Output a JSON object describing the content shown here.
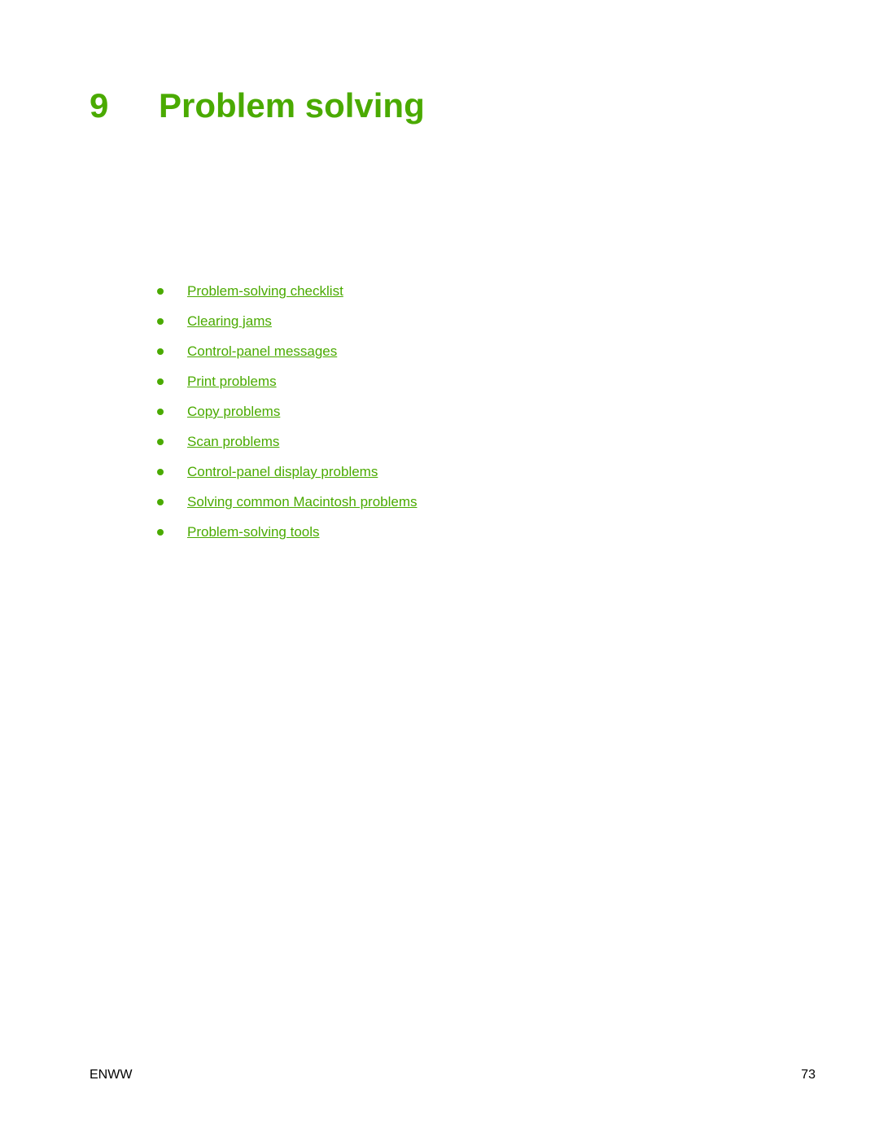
{
  "header": {
    "chapter_number": "9",
    "chapter_title": "Problem solving"
  },
  "colors": {
    "accent": "#4aaa00",
    "text": "#000000"
  },
  "toc": {
    "items": [
      {
        "label": "Problem-solving checklist"
      },
      {
        "label": "Clearing jams"
      },
      {
        "label": "Control-panel messages"
      },
      {
        "label": "Print problems"
      },
      {
        "label": "Copy problems"
      },
      {
        "label": "Scan problems"
      },
      {
        "label": "Control-panel display problems"
      },
      {
        "label": "Solving common Macintosh problems"
      },
      {
        "label": "Problem-solving tools"
      }
    ]
  },
  "footer": {
    "left": "ENWW",
    "page_number": "73"
  }
}
